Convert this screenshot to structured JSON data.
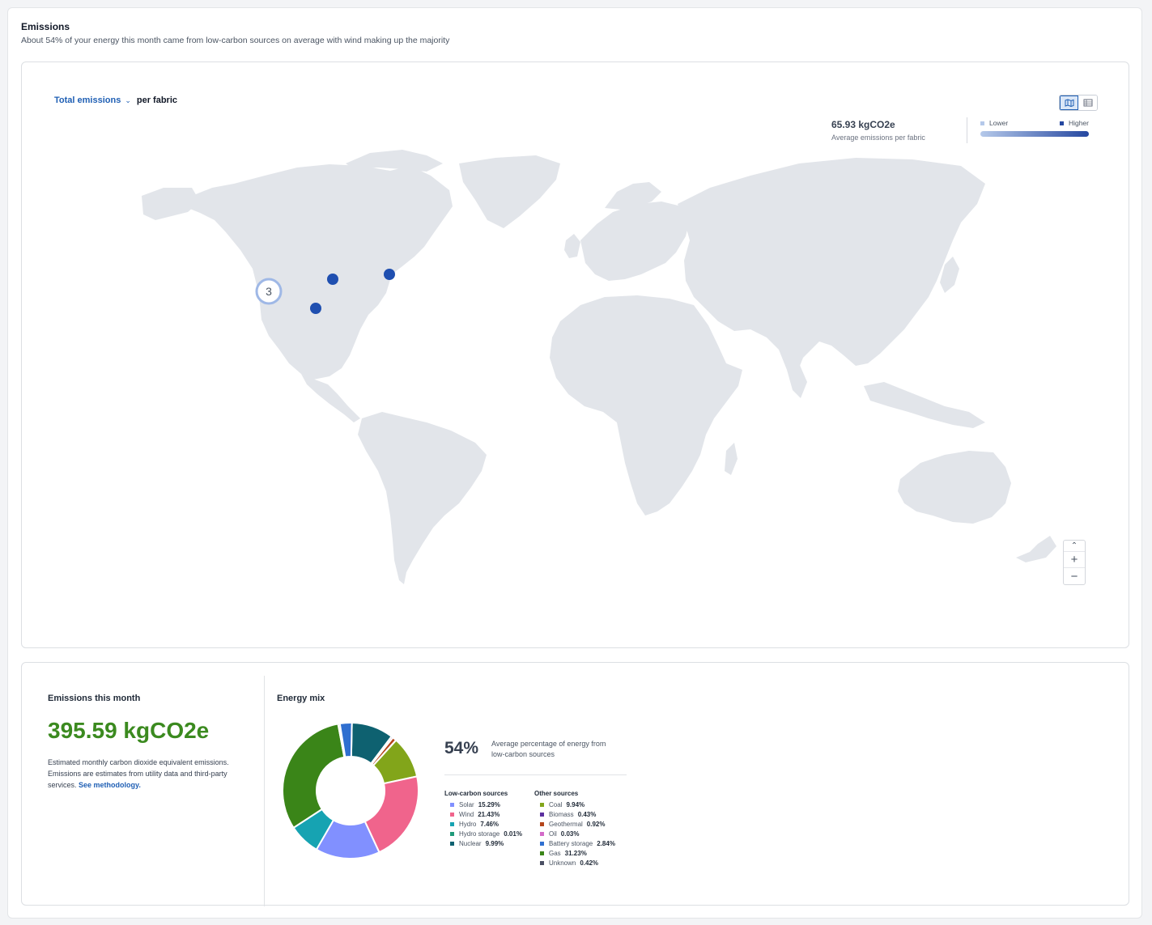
{
  "header": {
    "title": "Emissions",
    "subtitle": "About 54% of your energy this month came from low-carbon sources on average with wind making up the majority"
  },
  "map": {
    "metric_label": "Total emissions",
    "metric_suffix": "per fabric",
    "view_toggle": [
      "map-icon",
      "table-icon"
    ],
    "average_value": "65.93 kgCO2e",
    "average_label": "Average emissions per fabric",
    "legend_lower": "Lower",
    "legend_higher": "Higher",
    "colors": {
      "lower": "#b5c9ea",
      "higher": "#2547a0",
      "land": "#e2e5ea",
      "marker": "#1f4fb0"
    },
    "cluster_count": "3",
    "zoom_controls": [
      "chevron-up-icon",
      "plus-icon",
      "minus-icon"
    ]
  },
  "emissions_month": {
    "title": "Emissions this month",
    "value": "395.59 kgCO2e",
    "description": "Estimated monthly carbon dioxide equivalent emissions. Emissions are estimates from utility data and third-party services.",
    "link": "See methodology."
  },
  "energy_mix": {
    "title": "Energy mix",
    "percentage": "54%",
    "percentage_label": "Average percentage of energy from low-carbon sources",
    "low_carbon_title": "Low-carbon sources",
    "other_title": "Other sources",
    "low_carbon": [
      {
        "name": "Solar",
        "value": "15.29%",
        "num": 15.29,
        "color": "#8190ff"
      },
      {
        "name": "Wind",
        "value": "21.43%",
        "num": 21.43,
        "color": "#f0648c"
      },
      {
        "name": "Hydro",
        "value": "7.46%",
        "num": 7.46,
        "color": "#16a3b2"
      },
      {
        "name": "Hydro storage",
        "value": "0.01%",
        "num": 0.01,
        "color": "#1f9a7a"
      },
      {
        "name": "Nuclear",
        "value": "9.99%",
        "num": 9.99,
        "color": "#0e6170"
      }
    ],
    "other": [
      {
        "name": "Coal",
        "value": "9.94%",
        "num": 9.94,
        "color": "#82a51a"
      },
      {
        "name": "Biomass",
        "value": "0.43%",
        "num": 0.43,
        "color": "#5b2f9f"
      },
      {
        "name": "Geothermal",
        "value": "0.92%",
        "num": 0.92,
        "color": "#b4441a"
      },
      {
        "name": "Oil",
        "value": "0.03%",
        "num": 0.03,
        "color": "#d36ac8"
      },
      {
        "name": "Battery storage",
        "value": "2.84%",
        "num": 2.84,
        "color": "#2f6fd0"
      },
      {
        "name": "Gas",
        "value": "31.23%",
        "num": 31.23,
        "color": "#3a8518"
      },
      {
        "name": "Unknown",
        "value": "0.42%",
        "num": 0.42,
        "color": "#4a4f63"
      }
    ],
    "donut_order": [
      "Nuclear",
      "Biomass",
      "Geothermal",
      "Oil",
      "Coal",
      "Wind",
      "Solar",
      "Hydro",
      "Hydro storage",
      "Gas",
      "Unknown",
      "Battery storage"
    ]
  }
}
